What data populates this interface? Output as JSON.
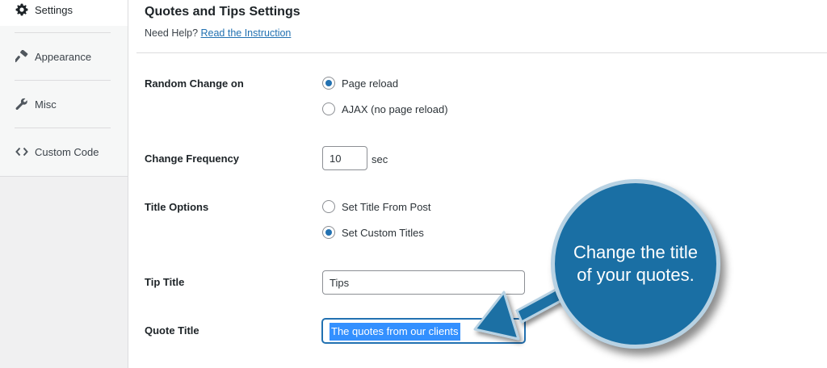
{
  "sidebar": {
    "items": [
      {
        "label": "Settings",
        "icon": "gear-icon"
      },
      {
        "label": "Appearance",
        "icon": "hammer-icon"
      },
      {
        "label": "Misc",
        "icon": "wrench-icon"
      },
      {
        "label": "Custom Code",
        "icon": "code-icon"
      }
    ]
  },
  "header": {
    "title": "Quotes and Tips Settings",
    "help_prefix": "Need Help?",
    "help_link": "Read the Instruction"
  },
  "form": {
    "random_change": {
      "label": "Random Change on",
      "options": [
        "Page reload",
        "AJAX (no page reload)"
      ],
      "selected": "Page reload"
    },
    "change_frequency": {
      "label": "Change Frequency",
      "value": "10",
      "unit": "sec"
    },
    "title_options": {
      "label": "Title Options",
      "options": [
        "Set Title From Post",
        "Set Custom Titles"
      ],
      "selected": "Set Custom Titles"
    },
    "tip_title": {
      "label": "Tip Title",
      "value": "Tips"
    },
    "quote_title": {
      "label": "Quote Title",
      "value": "The quotes from our clients"
    }
  },
  "callout": {
    "text": "Change the title of your quotes.",
    "color": "#1a6fa4"
  },
  "colors": {
    "accent": "#2271b1",
    "selection": "#3390ff"
  }
}
